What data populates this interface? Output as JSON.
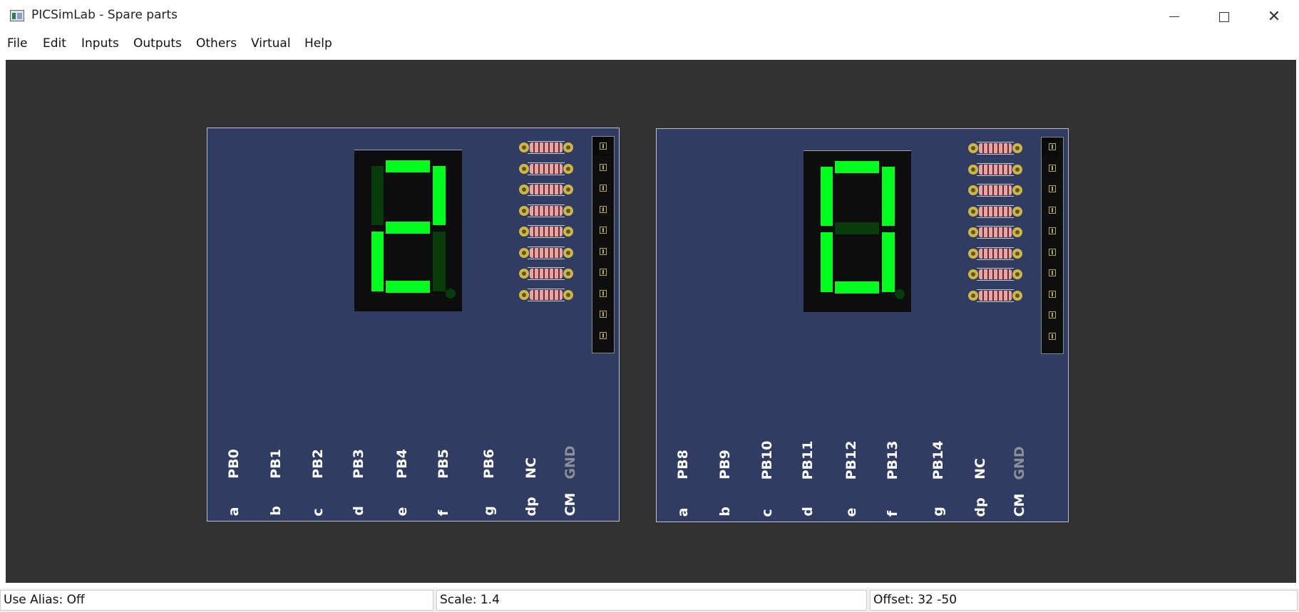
{
  "window": {
    "title": "PICSimLab - Spare parts"
  },
  "menu": [
    "File",
    "Edit",
    "Inputs",
    "Outputs",
    "Others",
    "Virtual",
    "Help"
  ],
  "boards": [
    {
      "segments": {
        "a": true,
        "b": true,
        "c": false,
        "d": true,
        "e": true,
        "f": false,
        "g": true,
        "dp": false
      },
      "pins": [
        {
          "pin": "PB0",
          "seg": "a"
        },
        {
          "pin": "PB1",
          "seg": "b"
        },
        {
          "pin": "PB2",
          "seg": "c"
        },
        {
          "pin": "PB3",
          "seg": "d"
        },
        {
          "pin": "PB4",
          "seg": "e"
        },
        {
          "pin": "PB5",
          "seg": "f"
        },
        {
          "pin": "PB6",
          "seg": "g"
        },
        {
          "pin": "NC",
          "seg": "dp"
        },
        {
          "pin": "GND",
          "seg": "CM"
        }
      ]
    },
    {
      "segments": {
        "a": true,
        "b": true,
        "c": true,
        "d": true,
        "e": true,
        "f": true,
        "g": false,
        "dp": false
      },
      "pins": [
        {
          "pin": "PB8",
          "seg": "a"
        },
        {
          "pin": "PB9",
          "seg": "b"
        },
        {
          "pin": "PB10",
          "seg": "c"
        },
        {
          "pin": "PB11",
          "seg": "d"
        },
        {
          "pin": "PB12",
          "seg": "e"
        },
        {
          "pin": "PB13",
          "seg": "f"
        },
        {
          "pin": "PB14",
          "seg": "g"
        },
        {
          "pin": "NC",
          "seg": "dp"
        },
        {
          "pin": "GND",
          "seg": "CM"
        }
      ]
    }
  ],
  "status": {
    "alias": "Use Alias: Off",
    "scale": "Scale: 1.4",
    "offset": "Offset:  32 -50"
  },
  "colors": {
    "canvas": "#323232",
    "board": "#313c63",
    "segment_on": "#00ff1e",
    "segment_off": "#093a0c"
  }
}
